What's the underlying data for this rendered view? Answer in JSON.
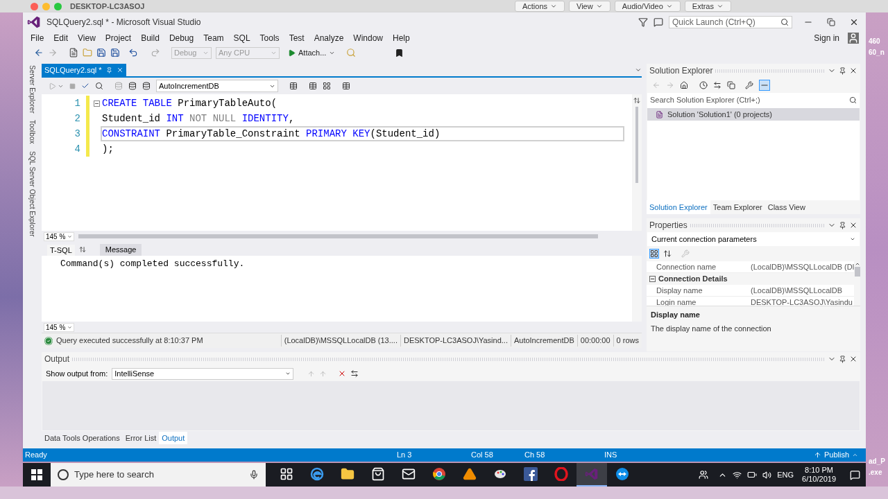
{
  "host_bar": {
    "title": "DESKTOP-LC3ASOJ",
    "buttons": [
      "Actions",
      "View",
      "Audio/Video",
      "Extras"
    ]
  },
  "window": {
    "title": "SQLQuery2.sql * - Microsoft Visual Studio",
    "quick_launch": {
      "placeholder": "Quick Launch (Ctrl+Q)"
    },
    "sign_in": "Sign in"
  },
  "menu": [
    "File",
    "Edit",
    "View",
    "Project",
    "Build",
    "Debug",
    "Team",
    "SQL",
    "Tools",
    "Test",
    "Analyze",
    "Window",
    "Help"
  ],
  "toolbar": {
    "configuration": "Debug",
    "platform": "Any CPU",
    "attach": "Attach..."
  },
  "side_tabs": [
    "Server Explorer",
    "Toolbox",
    "SQL Server Object Explorer"
  ],
  "document_tab": {
    "title": "SQLQuery2.sql *",
    "selected": true
  },
  "sql_toolbar": {
    "database": "AutoIncrementDB"
  },
  "editor": {
    "zoom": "145 %",
    "lines": [
      {
        "number": "1",
        "modified": true,
        "current": false,
        "foldable": true,
        "tokens": [
          {
            "kind": "keyword",
            "text": "CREATE TABLE"
          },
          {
            "kind": "plain",
            "text": " PrimaryTableAuto("
          }
        ]
      },
      {
        "number": "2",
        "modified": true,
        "current": false,
        "foldable": false,
        "tokens": [
          {
            "kind": "plain",
            "text": "Student_id "
          },
          {
            "kind": "keyword",
            "text": "INT"
          },
          {
            "kind": "operator",
            "text": " NOT NULL "
          },
          {
            "kind": "keyword",
            "text": "IDENTITY"
          },
          {
            "kind": "plain",
            "text": ","
          }
        ]
      },
      {
        "number": "3",
        "modified": true,
        "current": true,
        "foldable": false,
        "tokens": [
          {
            "kind": "keyword",
            "text": "CONSTRAINT"
          },
          {
            "kind": "plain",
            "text": " PrimaryTable_Constraint "
          },
          {
            "kind": "keyword",
            "text": "PRIMARY KEY"
          },
          {
            "kind": "plain",
            "text": "(Student_id)"
          }
        ]
      },
      {
        "number": "4",
        "modified": true,
        "current": false,
        "foldable": false,
        "tokens": [
          {
            "kind": "plain",
            "text": ");"
          }
        ]
      }
    ]
  },
  "results": {
    "mode": "T-SQL",
    "tabs": [
      {
        "label": "Message",
        "selected": true
      }
    ],
    "message": "Command(s) completed successfully.",
    "zoom": "145 %"
  },
  "query_status": {
    "message": "Query executed successfully at 8:10:37 PM",
    "fields": [
      "(LocalDB)\\MSSQLLocalDB (13....",
      "DESKTOP-LC3ASOJ\\Yasind...",
      "AutoIncrementDB",
      "00:00:00",
      "0 rows"
    ]
  },
  "solution_explorer": {
    "title": "Solution Explorer",
    "search": {
      "placeholder": "Search Solution Explorer (Ctrl+;)"
    },
    "items": [
      {
        "label": "Solution 'Solution1' (0 projects)",
        "selected": true
      }
    ],
    "tabs": [
      {
        "label": "Solution Explorer",
        "selected": true
      },
      {
        "label": "Team Explorer",
        "selected": false
      },
      {
        "label": "Class View",
        "selected": false
      }
    ]
  },
  "properties": {
    "title": "Properties",
    "object": "Current connection parameters",
    "rows": [
      {
        "kind": "property",
        "name": "Connection name",
        "value": "(LocalDB)\\MSSQLLocalDB (Dl"
      },
      {
        "kind": "category",
        "name": "Connection Details",
        "expanded": true
      },
      {
        "kind": "property",
        "name": "Display name",
        "value": "(LocalDB)\\MSSQLLocalDB"
      },
      {
        "kind": "property",
        "name": "Login name",
        "value": "DESKTOP-LC3ASOJ\\Yasindu"
      }
    ],
    "description_title": "Display name",
    "description": "The display name of the connection"
  },
  "output": {
    "title": "Output",
    "source_label": "Show output from:",
    "source": "IntelliSense"
  },
  "bottom_tabs": [
    {
      "label": "Data Tools Operations",
      "selected": false
    },
    {
      "label": "Error List",
      "selected": false
    },
    {
      "label": "Output",
      "selected": true
    }
  ],
  "status_bar": {
    "state": "Ready",
    "line": "Ln 3",
    "column": "Col 58",
    "char": "Ch 58",
    "mode": "INS",
    "publish": "Publish"
  },
  "taskbar": {
    "search": {
      "placeholder": "Type here to search"
    },
    "apps": [
      {
        "kind": "task-view",
        "selected": false
      },
      {
        "kind": "edge",
        "selected": false
      },
      {
        "kind": "explorer",
        "selected": false
      },
      {
        "kind": "store",
        "selected": false
      },
      {
        "kind": "mail",
        "selected": false
      },
      {
        "kind": "chrome",
        "selected": false
      },
      {
        "kind": "vlc",
        "selected": false
      },
      {
        "kind": "paint",
        "selected": false
      },
      {
        "kind": "facebook",
        "selected": false
      },
      {
        "kind": "opera",
        "selected": false
      },
      {
        "kind": "visual-studio",
        "selected": true
      },
      {
        "kind": "teamviewer",
        "selected": false
      }
    ],
    "language": "ENG",
    "time": "8:10 PM",
    "date": "6/10/2019"
  },
  "desktop_labels": [
    "460",
    "60_n",
    "ad_P",
    ".exe"
  ]
}
